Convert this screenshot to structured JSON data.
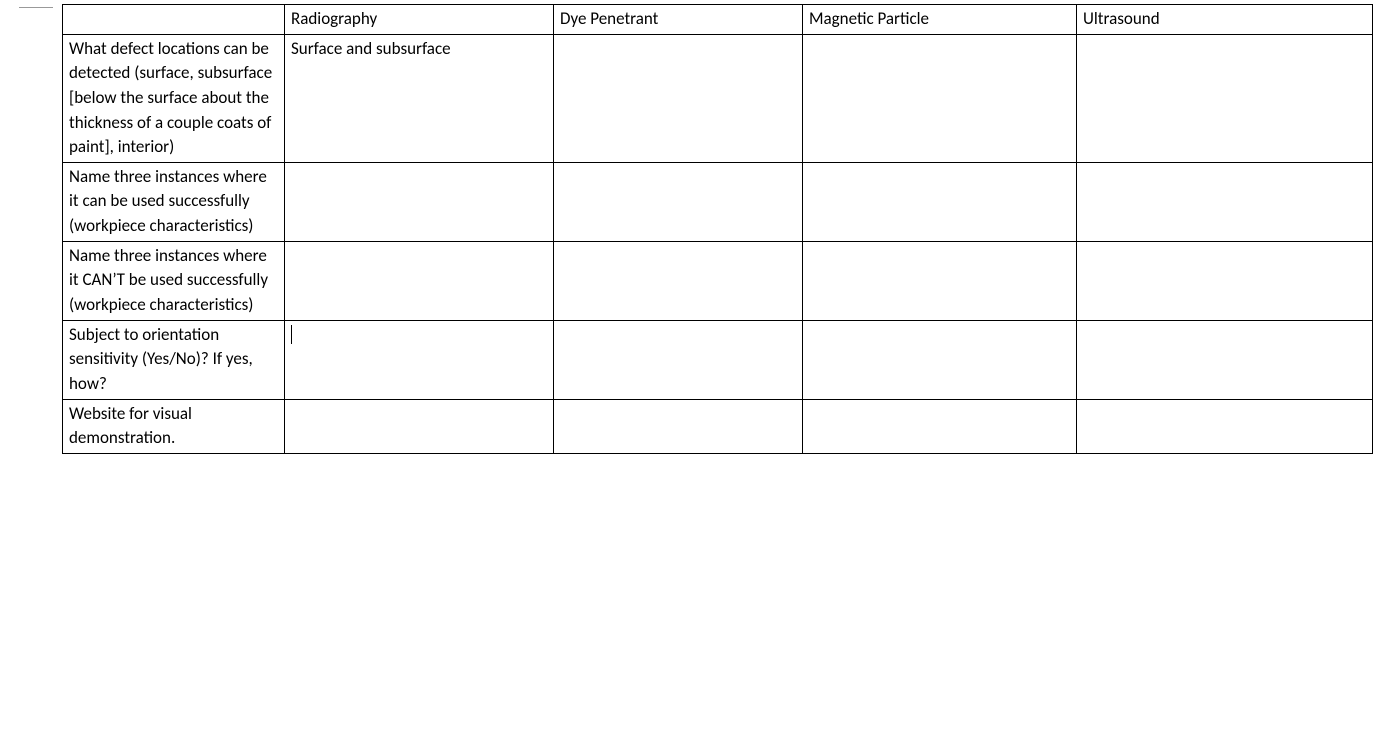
{
  "table": {
    "headers": {
      "col0": "",
      "col1": "Radiography",
      "col2": "Dye Penetrant",
      "col3": "Magnetic Particle",
      "col4": "Ultrasound"
    },
    "rows": [
      {
        "label": "What defect locations can be detected (surface, subsurface [below the surface about the thickness of a couple coats of paint], interior)",
        "radiography": "Surface and subsurface",
        "dye_penetrant": "",
        "magnetic_particle": "",
        "ultrasound": ""
      },
      {
        "label": "Name three instances where it can be used successfully (workpiece characteristics)",
        "radiography": "",
        "dye_penetrant": "",
        "magnetic_particle": "",
        "ultrasound": ""
      },
      {
        "label": "Name three instances where it CAN’T be used successfully (workpiece characteristics)",
        "radiography": "",
        "dye_penetrant": "",
        "magnetic_particle": "",
        "ultrasound": ""
      },
      {
        "label": "Subject to orientation sensitivity (Yes/No)? If yes, how?",
        "radiography": "",
        "dye_penetrant": "",
        "magnetic_particle": "",
        "ultrasound": ""
      },
      {
        "label": "Website for visual demonstration.",
        "radiography": "",
        "dye_penetrant": "",
        "magnetic_particle": "",
        "ultrasound": ""
      }
    ]
  }
}
